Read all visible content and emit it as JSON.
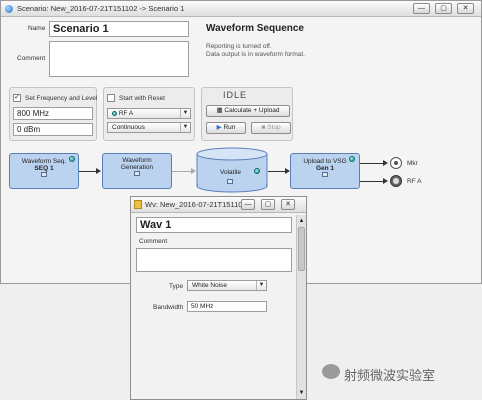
{
  "main_window": {
    "title": "Scenario: New_2016-07-21T151102 -> Scenario 1",
    "controls": {
      "minimize": "—",
      "restore": "▢",
      "close": "✕"
    }
  },
  "scenario": {
    "name_label": "Name",
    "name_value": "Scenario 1",
    "comment_label": "Comment",
    "heading": "Waveform Sequence",
    "info_line1": "Reporting is turned off.",
    "info_line2": "Data output is in waveform format."
  },
  "freq_level": {
    "checkbox_label": "Set Frequency and Level",
    "checked": true,
    "frequency": "800 MHz",
    "level": "0 dBm"
  },
  "reset": {
    "checkbox_label": "Start with Reset",
    "checked": false,
    "rf_select": "RF A",
    "mode_select": "Continuous"
  },
  "run": {
    "status": "IDLE",
    "calc_upload_label": "Calculate + Upload",
    "run_label": "Run",
    "stop_label": "Stop"
  },
  "flow": {
    "block1_title": "Waveform Seq.",
    "block1_sub": "SEQ 1",
    "block2_title": "Waveform",
    "block2_title2": "Generation",
    "storage_label": "Volatile",
    "block4_title": "Upload to VSG",
    "block4_sub": "Gen 1",
    "out_mkr": "Mkr",
    "out_rfa": "RF A"
  },
  "sub_window": {
    "title": "Wv: New_2016-07-21T151102 ...",
    "name_value": "Wav 1",
    "comment_label": "Comment",
    "type_label": "Type",
    "type_value": "White Noise",
    "bandwidth_label": "Bandwidth",
    "bandwidth_value": "50 MHz"
  },
  "watermark": {
    "text": "射频微波实验室"
  },
  "colors": {
    "block_fill": "#bcd3f0",
    "led": "#138c8c",
    "window_bg": "#f4f4f4"
  }
}
